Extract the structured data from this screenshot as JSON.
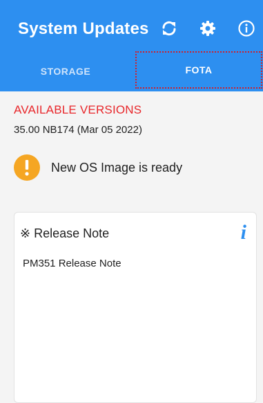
{
  "header": {
    "title": "System Updates",
    "actions": [
      {
        "name": "refresh-icon",
        "glyph": "sync"
      },
      {
        "name": "gear-icon",
        "glyph": "settings"
      },
      {
        "name": "info-circle-icon",
        "glyph": "info"
      }
    ],
    "tabs": [
      {
        "label": "STORAGE",
        "selected": false
      },
      {
        "label": "FOTA",
        "selected": true
      }
    ]
  },
  "main": {
    "section_heading": "AVAILABLE VERSIONS",
    "version": "35.00 NB174 (Mar 05 2022)",
    "notice": {
      "icon": "exclamation-icon",
      "text": "New OS Image is ready"
    },
    "release_card": {
      "title": "※ Release Note",
      "info_glyph": "i",
      "body": "PM351 Release Note"
    }
  },
  "colors": {
    "appbar": "#2d8ff0",
    "accent_red": "#e8262a",
    "warning": "#f5a623"
  }
}
